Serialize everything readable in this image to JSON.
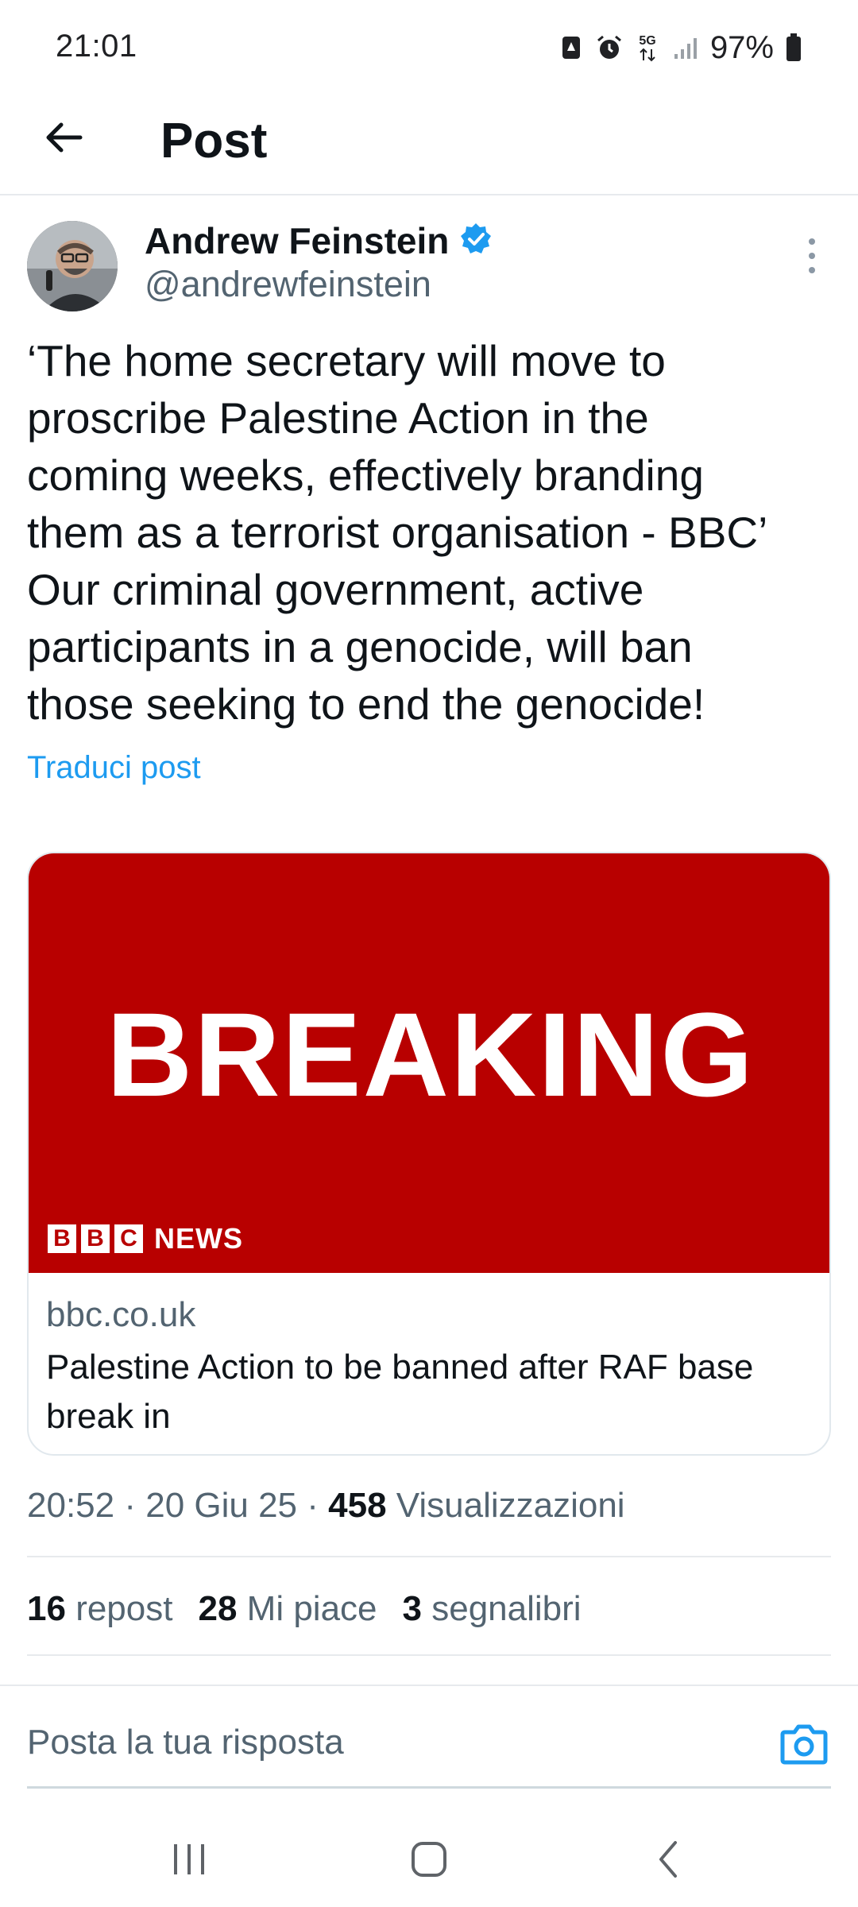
{
  "status_bar": {
    "time": "21:01",
    "network": "5G",
    "battery": "97%",
    "icons": [
      "notification-icon",
      "alarm-icon",
      "network-5g-icon",
      "signal-icon",
      "battery-icon"
    ]
  },
  "header": {
    "title": "Post",
    "back_icon": "back-arrow-icon"
  },
  "author": {
    "name": "Andrew Feinstein",
    "handle": "@andrewfeinstein",
    "verified": true
  },
  "post": {
    "text": "‘The home secretary will move to\nproscribe Palestine Action in the\ncoming weeks, effectively branding\nthem as a terrorist organisation - BBC’\nOur criminal government, active\nparticipants in a genocide, will ban\nthose seeking to end the genocide!",
    "translate_label": "Traduci post"
  },
  "card": {
    "image_headline": "BREAKING",
    "image_logo_letters": [
      "B",
      "B",
      "C"
    ],
    "image_logo_suffix": "NEWS",
    "domain": "bbc.co.uk",
    "title": "Palestine Action to be banned after RAF base break in"
  },
  "meta": {
    "time": "20:52",
    "date": "20 Giu 25",
    "views_count": "458",
    "views_label": "Visualizzazioni"
  },
  "stats": [
    {
      "count": "16",
      "label": "repost"
    },
    {
      "count": "28",
      "label": "Mi piace"
    },
    {
      "count": "3",
      "label": "segnalibri"
    }
  ],
  "reply": {
    "placeholder": "Posta la tua risposta"
  },
  "colors": {
    "accent": "#1d9bf0",
    "bbc_red": "#b80000",
    "text_primary": "#0f1419",
    "text_secondary": "#536471"
  }
}
